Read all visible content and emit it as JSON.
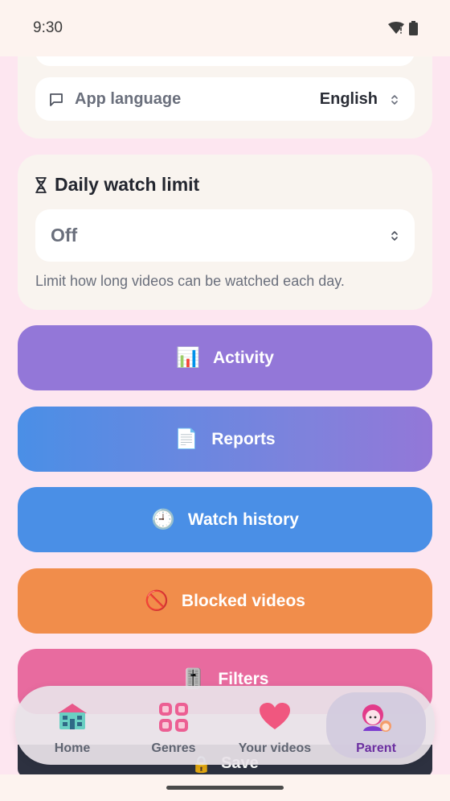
{
  "status": {
    "time": "9:30"
  },
  "settings": {
    "language_label": "App language",
    "language_value": "English"
  },
  "watch_limit": {
    "title": "Daily watch limit",
    "selected": "Off",
    "helper": "Limit how long videos can be watched each day."
  },
  "actions": [
    {
      "emoji": "📊",
      "label": "Activity",
      "color": "#9377d8"
    },
    {
      "emoji": "📄",
      "label": "Reports",
      "color": "#5f8fe6"
    },
    {
      "emoji": "🕘",
      "label": "Watch history",
      "color": "#4a8fe6"
    },
    {
      "emoji": "🚫",
      "label": "Blocked videos",
      "color": "#f18d4b"
    },
    {
      "emoji": "🎚️",
      "label": "Filters",
      "color": "#e86b9f"
    }
  ],
  "save": {
    "emoji": "🔒",
    "label": "Save"
  },
  "nav": {
    "home": "Home",
    "genres": "Genres",
    "your_videos": "Your videos",
    "parent": "Parent"
  }
}
